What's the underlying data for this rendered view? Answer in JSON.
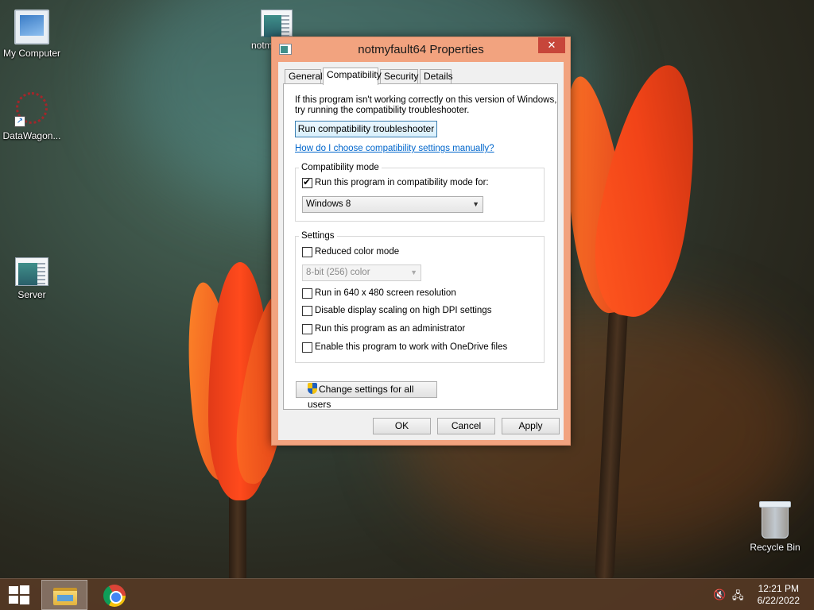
{
  "desktop": {
    "icons": [
      {
        "label": "My Computer"
      },
      {
        "label": "notm"
      },
      {
        "label": "DataWagon..."
      },
      {
        "label": "Server"
      },
      {
        "label": "Recycle Bin"
      }
    ]
  },
  "dialog": {
    "title": "notmyfault64 Properties",
    "close_glyph": "✕",
    "tabs": [
      {
        "label": "General"
      },
      {
        "label": "Compatibility"
      },
      {
        "label": "Security"
      },
      {
        "label": "Details"
      }
    ],
    "active_tab": "Compatibility",
    "intro_line1": "If this program isn't working correctly on this version of Windows,",
    "intro_line2": "try running the compatibility troubleshooter.",
    "troubleshooter_button": "Run compatibility troubleshooter",
    "manual_link": "How do I choose compatibility settings manually?",
    "compat_mode": {
      "group_label": "Compatibility mode",
      "checkbox_label": "Run this program in compatibility mode for:",
      "checked": true,
      "selected_os": "Windows 8"
    },
    "settings": {
      "group_label": "Settings",
      "reduced_color_label": "Reduced color mode",
      "color_depth_selected": "8-bit (256) color",
      "resolution_label": "Run in 640 x 480 screen resolution",
      "dpi_label": "Disable display scaling on high DPI settings",
      "admin_label": "Run this program as an administrator",
      "onedrive_label": "Enable this program to work with OneDrive files"
    },
    "all_users_button": "Change settings for all users",
    "ok_button": "OK",
    "cancel_button": "Cancel",
    "apply_button": "Apply"
  },
  "taskbar": {
    "time": "12:21 PM",
    "date": "6/22/2022",
    "volume_glyph": "🔇",
    "network_glyph": "🖧"
  },
  "colors": {
    "window_frame": "#f2a37f",
    "close_button": "#c7463a",
    "link": "#0066cc",
    "taskbar": "#5c3c26"
  }
}
